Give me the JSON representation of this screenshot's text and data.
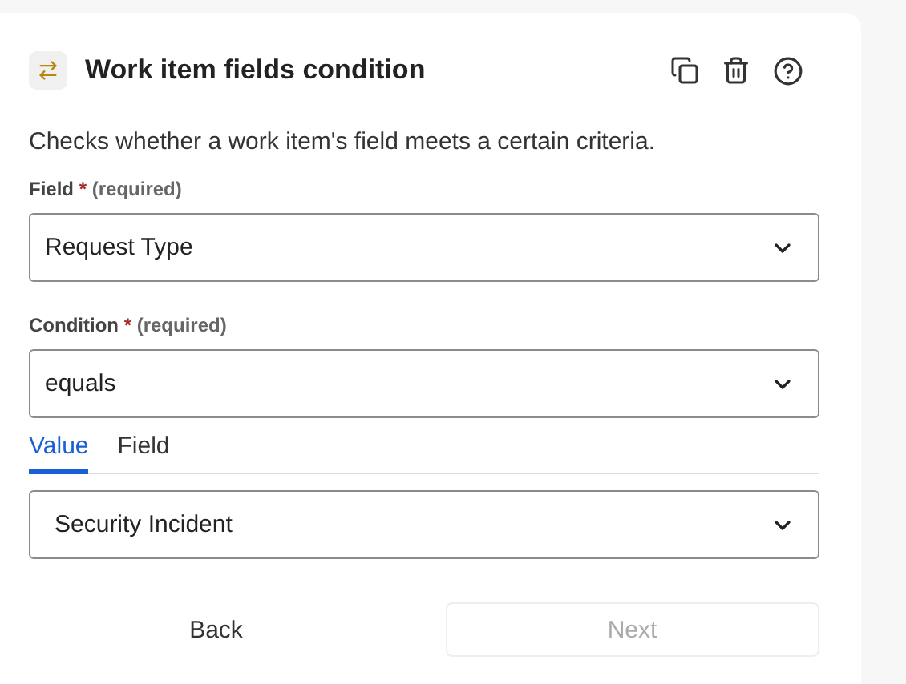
{
  "header": {
    "title": "Work item fields condition"
  },
  "description": "Checks whether a work item's field meets a certain criteria.",
  "fields": [
    {
      "label": "Field",
      "star": "*",
      "hint": "(required)",
      "value": "Request Type"
    },
    {
      "label": "Condition",
      "star": "*",
      "hint": "(required)",
      "value": "equals"
    }
  ],
  "tabs": [
    {
      "label": "Value",
      "selected": true
    },
    {
      "label": "Field",
      "selected": false
    }
  ],
  "value_select": {
    "value": "Security Incident"
  },
  "buttons": [
    {
      "label": "Back",
      "disabled": false,
      "kind": "plain"
    },
    {
      "label": "Next",
      "disabled": true,
      "kind": "outlined"
    }
  ]
}
